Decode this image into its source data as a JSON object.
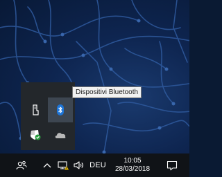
{
  "tooltip": {
    "text": "Dispositivi Bluetooth"
  },
  "overflow_tray": {
    "icons": [
      {
        "name": "windows-ink-pen-icon"
      },
      {
        "name": "bluetooth-icon",
        "highlighted": true
      },
      {
        "name": "windows-defender-icon"
      },
      {
        "name": "onedrive-icon"
      }
    ]
  },
  "taskbar": {
    "people_icon": "people-icon",
    "chevron_icon": "chevron-up-icon",
    "network_icon": "network-warning-icon",
    "volume_icon": "speaker-volume-icon",
    "language": "DEU",
    "clock": {
      "time": "10:05",
      "date": "28/03/2018"
    },
    "action_center_icon": "action-center-icon"
  },
  "colors": {
    "taskbar_bg": "#101317",
    "tray_panel_bg": "#23272b",
    "bluetooth_blue": "#1d74d6",
    "defender_green": "#2a9d3f",
    "network_warning": "#f2c200",
    "wallpaper": "#0e2550"
  }
}
